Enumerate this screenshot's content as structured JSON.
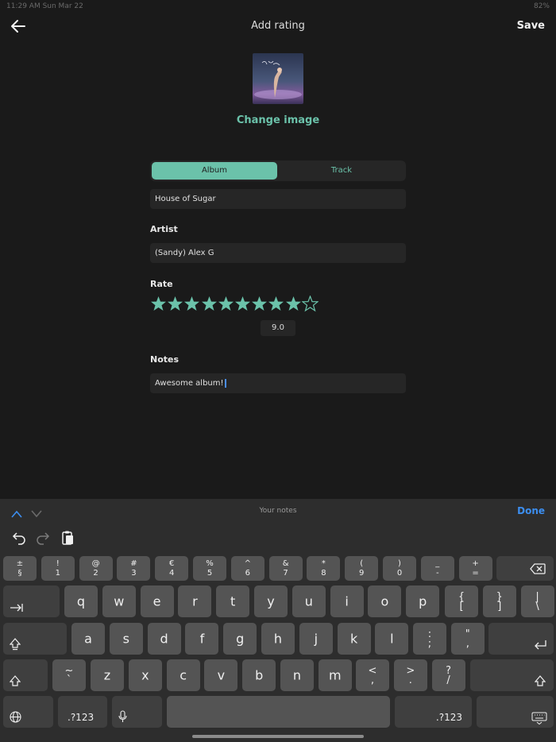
{
  "status": {
    "time": "11:29 AM  Sun Mar 22",
    "battery": "82%"
  },
  "header": {
    "title": "Add rating",
    "save_label": "Save"
  },
  "cover": {
    "change_label": "Change image"
  },
  "segment": {
    "album_label": "Album",
    "track_label": "Track",
    "selected": "Album"
  },
  "form": {
    "title_value": "House of Sugar",
    "artist_label": "Artist",
    "artist_value": "(Sandy) Alex G",
    "rate_label": "Rate",
    "rating": 9.0,
    "max_rating": 10,
    "rating_display": "9.0",
    "notes_label": "Notes",
    "notes_value": "Awesome album!"
  },
  "keyboard": {
    "toolbar_label": "Your notes",
    "done_label": "Done",
    "row_numbers": [
      {
        "top": "±",
        "bottom": "§"
      },
      {
        "top": "!",
        "bottom": "1"
      },
      {
        "top": "@",
        "bottom": "2"
      },
      {
        "top": "#",
        "bottom": "3"
      },
      {
        "top": "€",
        "bottom": "4"
      },
      {
        "top": "%",
        "bottom": "5"
      },
      {
        "top": "^",
        "bottom": "6"
      },
      {
        "top": "&",
        "bottom": "7"
      },
      {
        "top": "*",
        "bottom": "8"
      },
      {
        "top": "(",
        "bottom": "9"
      },
      {
        "top": ")",
        "bottom": "0"
      },
      {
        "top": "_",
        "bottom": "-"
      },
      {
        "top": "+",
        "bottom": "="
      }
    ],
    "row_q": [
      "q",
      "w",
      "e",
      "r",
      "t",
      "y",
      "u",
      "i",
      "o",
      "p"
    ],
    "row_q_extra": [
      {
        "top": "{",
        "bottom": "["
      },
      {
        "top": "}",
        "bottom": "]"
      },
      {
        "top": "|",
        "bottom": "\\"
      }
    ],
    "row_a": [
      "a",
      "s",
      "d",
      "f",
      "g",
      "h",
      "j",
      "k",
      "l"
    ],
    "row_a_extra": [
      {
        "top": ":",
        "bottom": ";"
      },
      {
        "top": "\"",
        "bottom": ","
      }
    ],
    "row_z_first": {
      "top": "~",
      "bottom": "`"
    },
    "row_z": [
      "z",
      "x",
      "c",
      "v",
      "b",
      "n",
      "m"
    ],
    "row_z_extra": [
      {
        "top": "<",
        "bottom": ","
      },
      {
        "top": ">",
        "bottom": "."
      },
      {
        "top": "?",
        "bottom": "/"
      }
    ],
    "mode_label": ".?123"
  },
  "colors": {
    "accent": "#6bc2aa",
    "done": "#3c8ef0",
    "background": "#1a1a1a",
    "keyboard": "#2d2d2d"
  }
}
